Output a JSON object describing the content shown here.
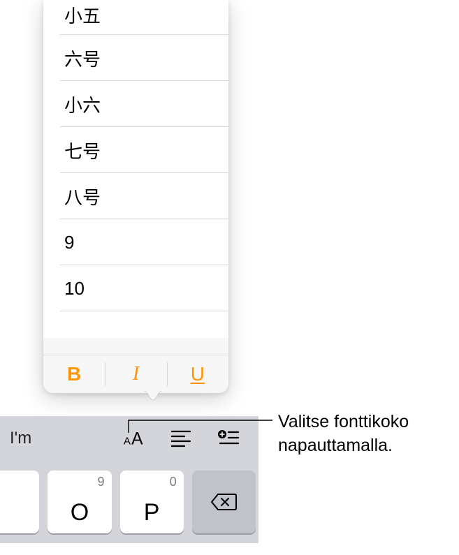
{
  "popover": {
    "sizes": [
      "小五",
      "六号",
      "小六",
      "七号",
      "八号",
      "9",
      "10"
    ],
    "biu": {
      "bold": "B",
      "italic": "I",
      "underline": "U"
    }
  },
  "toolbar": {
    "suggestion": "I'm"
  },
  "keys": [
    {
      "small": "9",
      "main": "O"
    },
    {
      "small": "0",
      "main": "P"
    }
  ],
  "callout": {
    "line1": "Valitse fonttikoko",
    "line2": "napauttamalla."
  }
}
